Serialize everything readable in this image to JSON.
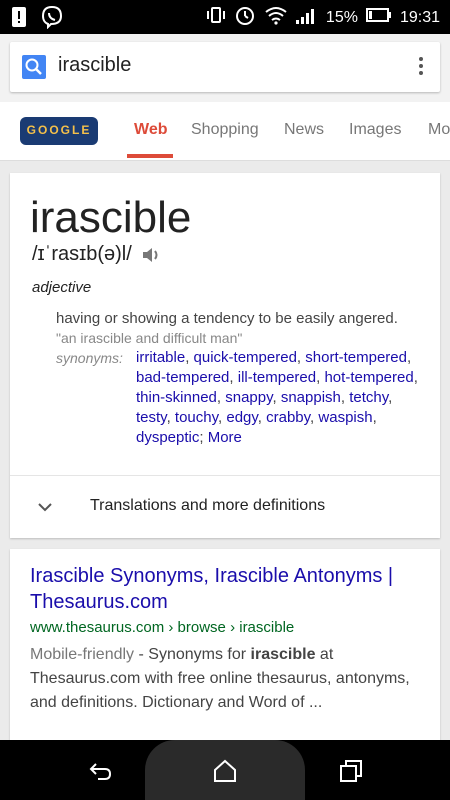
{
  "status_bar": {
    "battery_percent": "15%",
    "time": "19:31"
  },
  "search": {
    "query": "irascible"
  },
  "tabs": [
    {
      "label": "Web",
      "active": true
    },
    {
      "label": "Shopping",
      "active": false
    },
    {
      "label": "News",
      "active": false
    },
    {
      "label": "Images",
      "active": false
    },
    {
      "label": "Mo",
      "active": false
    }
  ],
  "doodle": {
    "text": "GOOGLE"
  },
  "dictionary": {
    "word": "irascible",
    "pronunciation": "/ɪˈrasɪb(ə)l/",
    "part_of_speech": "adjective",
    "definition": "having or showing a tendency to be easily angered.",
    "example": "\"an irascible and difficult man\"",
    "synonyms_label": "synonyms:",
    "synonyms": [
      "irritable",
      "quick-tempered",
      "short-tempered",
      "bad-tempered",
      "ill-tempered",
      "hot-tempered",
      "thin-skinned",
      "snappy",
      "snappish",
      "tetchy",
      "testy",
      "touchy",
      "edgy",
      "crabby",
      "waspish",
      "dyspeptic"
    ],
    "more_label": "More",
    "translations_label": "Translations and more definitions"
  },
  "result": {
    "title": "Irascible Synonyms, Irascible Antonyms | Thesaurus.com",
    "url": "www.thesaurus.com › browse › irascible",
    "mobile_friendly": "Mobile-friendly",
    "snippet_prefix": " - Synonyms for ",
    "snippet_bold": "irascible",
    "snippet_suffix": " at Thesaurus.com with free online thesaurus, antonyms, and definitions. Dictionary and Word of ..."
  },
  "colors": {
    "accent_red": "#dd4b39",
    "link_blue": "#1a0dab",
    "url_green": "#006621",
    "search_blue": "#4285f4"
  }
}
